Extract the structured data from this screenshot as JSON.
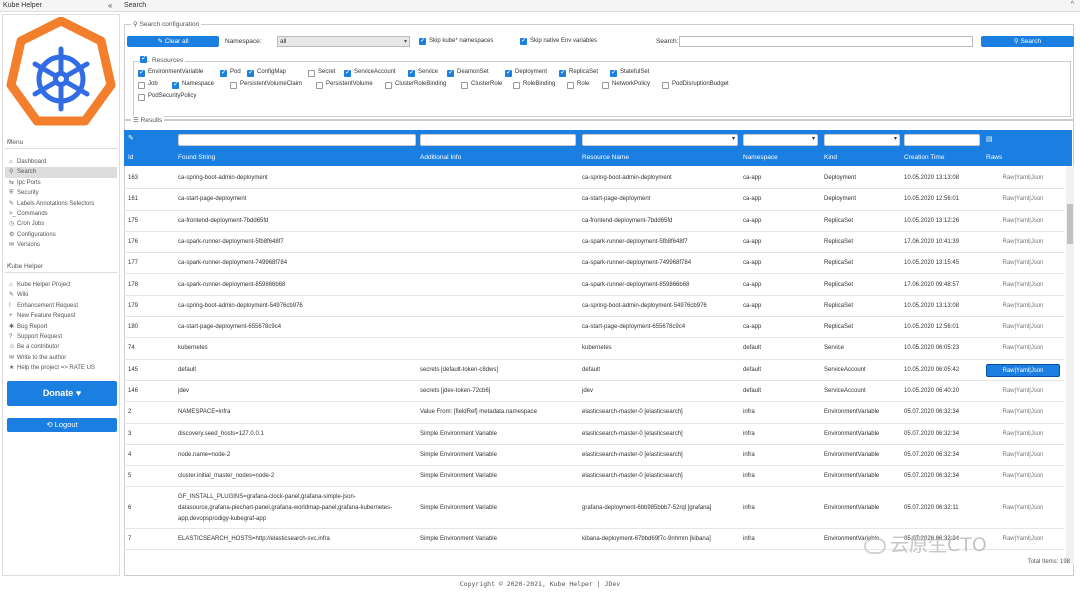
{
  "titlebar": {
    "left_title": "Kube Helper",
    "collapse": "«",
    "right_title": "Search",
    "up": "^"
  },
  "menu": {
    "title": "Menu",
    "items": [
      {
        "icon": "⌂",
        "label": "Dashboard"
      },
      {
        "icon": "⚲",
        "label": "Search"
      },
      {
        "icon": "⇆",
        "label": "Ipc Ports"
      },
      {
        "icon": "⛨",
        "label": "Security"
      },
      {
        "icon": "✎",
        "label": "Labels Annotations Selectors"
      },
      {
        "icon": ">_",
        "label": "Commands"
      },
      {
        "icon": "◷",
        "label": "Cron Jobs"
      },
      {
        "icon": "⚙",
        "label": "Configurations"
      },
      {
        "icon": "✉",
        "label": "Versions"
      }
    ]
  },
  "kube_menu": {
    "title": "Kube Helper",
    "items": [
      {
        "icon": "⌂",
        "label": "Kube Helper Project"
      },
      {
        "icon": "✎",
        "label": "Wiki"
      },
      {
        "icon": "!",
        "label": "Enhancement Request"
      },
      {
        "icon": "+",
        "label": "New Feature Request"
      },
      {
        "icon": "✱",
        "label": "Bug Report"
      },
      {
        "icon": "?",
        "label": "Support Request"
      },
      {
        "icon": "☺",
        "label": "Be a contributor"
      },
      {
        "icon": "✉",
        "label": "Write to the author"
      },
      {
        "icon": "★",
        "label": "Help the project => RATE US"
      }
    ]
  },
  "donate_label": "Donate ♥",
  "logout_label": "⟲ Logout",
  "search_config": {
    "legend": "⚲ Search configuration",
    "clear_all": "✎ Clear all",
    "namespace_label": "Namespace:",
    "namespace_value": "all",
    "skip_kube": "Skip kube* namespaces",
    "skip_env": "Skip native Env variables",
    "search_label": "Search:",
    "search_value": "",
    "search_button": "⚲ Search",
    "resources_legend": "Resources",
    "resources": [
      {
        "label": "EnvironmentVariable",
        "checked": true
      },
      {
        "label": "Pod",
        "checked": true
      },
      {
        "label": "ConfigMap",
        "checked": true
      },
      {
        "label": "Secret",
        "checked": false
      },
      {
        "label": "ServiceAccount",
        "checked": true
      },
      {
        "label": "Service",
        "checked": true
      },
      {
        "label": "DeamonSet",
        "checked": true
      },
      {
        "label": "Deployment",
        "checked": true
      },
      {
        "label": "ReplicaSet",
        "checked": true
      },
      {
        "label": "StatefulSet",
        "checked": true
      },
      {
        "label": "Job",
        "checked": false
      },
      {
        "label": "Namespace",
        "checked": true
      },
      {
        "label": "PersistentVolumeClaim",
        "checked": false
      },
      {
        "label": "PersistentVolume",
        "checked": false
      },
      {
        "label": "ClusterRoleBinding",
        "checked": false
      },
      {
        "label": "ClusterRole",
        "checked": false
      },
      {
        "label": "RoleBinding",
        "checked": false
      },
      {
        "label": "Role",
        "checked": false
      },
      {
        "label": "NetworkPolicy",
        "checked": false
      },
      {
        "label": "PodDisruptionBudget",
        "checked": false
      },
      {
        "label": "PodSecurityPolicy",
        "checked": false
      }
    ]
  },
  "results": {
    "legend": "☰ Results",
    "columns": [
      "Id",
      "Found String",
      "Additional Info",
      "Resource Name",
      "Namespace",
      "Kind",
      "Creation Time",
      "Raws"
    ],
    "rows": [
      {
        "id": "163",
        "found": "ca-spring-boot-admin-deployment",
        "info": "",
        "name": "ca-spring-boot-admin-deployment",
        "ns": "ca-app",
        "kind": "Deployment",
        "time": "10.05.2020 13:13:08",
        "raw": "Raw|Yaml|Json"
      },
      {
        "id": "161",
        "found": "ca-start-page-deployment",
        "info": "",
        "name": "ca-start-page-deployment",
        "ns": "ca-app",
        "kind": "Deployment",
        "time": "10.05.2020 12:56:01",
        "raw": "Raw|Yaml|Json"
      },
      {
        "id": "175",
        "found": "ca-frontend-deployment-7bdd65fd",
        "info": "",
        "name": "ca-frontend-deployment-7bdd65fd",
        "ns": "ca-app",
        "kind": "ReplicaSet",
        "time": "10.05.2020 13:12:26",
        "raw": "Raw|Yaml|Json"
      },
      {
        "id": "176",
        "found": "ca-spark-runner-deployment-5fb8f648f7",
        "info": "",
        "name": "ca-spark-runner-deployment-5fb8f648f7",
        "ns": "ca-app",
        "kind": "ReplicaSet",
        "time": "17.06.2020 10:41:39",
        "raw": "Raw|Yaml|Json"
      },
      {
        "id": "177",
        "found": "ca-spark-runner-deployment-749968f784",
        "info": "",
        "name": "ca-spark-runner-deployment-749968f784",
        "ns": "ca-app",
        "kind": "ReplicaSet",
        "time": "10.05.2020 13:15:45",
        "raw": "Raw|Yaml|Json"
      },
      {
        "id": "178",
        "found": "ca-spark-runner-deployment-859866b68",
        "info": "",
        "name": "ca-spark-runner-deployment-859866b68",
        "ns": "ca-app",
        "kind": "ReplicaSet",
        "time": "17.06.2020 09:48:57",
        "raw": "Raw|Yaml|Json"
      },
      {
        "id": "179",
        "found": "ca-spring-boot-admin-deployment-54976cb976",
        "info": "",
        "name": "ca-spring-boot-admin-deployment-54976cb976",
        "ns": "ca-app",
        "kind": "ReplicaSet",
        "time": "10.05.2020 13:13:08",
        "raw": "Raw|Yaml|Json"
      },
      {
        "id": "180",
        "found": "ca-start-page-deployment-655678c9c4",
        "info": "",
        "name": "ca-start-page-deployment-655678c9c4",
        "ns": "ca-app",
        "kind": "ReplicaSet",
        "time": "10.05.2020 12:56:01",
        "raw": "Raw|Yaml|Json"
      },
      {
        "id": "74",
        "found": "kubernetes",
        "info": "",
        "name": "kubernetes",
        "ns": "default",
        "kind": "Service",
        "time": "10.05.2020 06:05:23",
        "raw": "Raw|Yaml|Json"
      },
      {
        "id": "145",
        "found": "default",
        "info": "secrets [default-token-c8dws]",
        "name": "default",
        "ns": "default",
        "kind": "ServiceAccount",
        "time": "10.05.2020 06:05:42",
        "raw": "Raw|Yaml|Json"
      },
      {
        "id": "146",
        "found": "jdev",
        "info": "secrets [jdev-token-72cb6]",
        "name": "jdev",
        "ns": "default",
        "kind": "ServiceAccount",
        "time": "10.05.2020 06:40:20",
        "raw": "Raw|Yaml|Json"
      },
      {
        "id": "2",
        "found": "NAMESPACE=infra",
        "info": "Value From: [fieldRef] metadata.namespace",
        "name": "elasticsearch-master-0 [elasticsearch]",
        "ns": "infra",
        "kind": "EnvironmentVariable",
        "time": "05.07.2020 06:32:34",
        "raw": "Raw|Yaml|Json"
      },
      {
        "id": "3",
        "found": "discovery.seed_hosts=127.0.0.1",
        "info": "Simple Environment Variable",
        "name": "elasticsearch-master-0 [elasticsearch]",
        "ns": "infra",
        "kind": "EnvironmentVariable",
        "time": "05.07.2020 06:32:34",
        "raw": "Raw|Yaml|Json"
      },
      {
        "id": "4",
        "found": "node.name=node-2",
        "info": "Simple Environment Variable",
        "name": "elasticsearch-master-0 [elasticsearch]",
        "ns": "infra",
        "kind": "EnvironmentVariable",
        "time": "05.07.2020 06:32:34",
        "raw": "Raw|Yaml|Json"
      },
      {
        "id": "5",
        "found": "cluster.initial_master_nodes=node-2",
        "info": "Simple Environment Variable",
        "name": "elasticsearch-master-0 [elasticsearch]",
        "ns": "infra",
        "kind": "EnvironmentVariable",
        "time": "05.07.2020 06:32:34",
        "raw": "Raw|Yaml|Json"
      },
      {
        "id": "6",
        "found": "GF_INSTALL_PLUGINS=grafana-clock-panel,grafana-simple-json-\ndatasource,grafana-piechart-panel,grafana-worldmap-panel,grafana-kubernetes-\napp,devopsprodigy-kubegraf-app",
        "info": "Simple Environment Variable",
        "name": "grafana-deployment-6bb985bbb7-52rql [grafana]",
        "ns": "infra",
        "kind": "EnvironmentVariable",
        "time": "05.07.2020 06:32:11",
        "raw": "Raw|Yaml|Json"
      },
      {
        "id": "7",
        "found": "ELASTICSEARCH_HOSTS=http://elasticsearch-svc.infra",
        "info": "Simple Environment Variable",
        "name": "kibana-deployment-67bbd69f7c-9nhmm [kibana]",
        "ns": "infra",
        "kind": "EnvironmentVariable",
        "time": "05.07.2020 06:32:34",
        "raw": "Raw|Yaml|Json"
      }
    ],
    "total": "Total Items: 198"
  },
  "watermark": "云原生CTO",
  "footer": "Copyright © 2020-2021, Kube Helper   |   JDev",
  "colors": {
    "accent": "#1a7fe0",
    "logo_orange": "#f37e2c",
    "logo_blue": "#326ce5"
  }
}
